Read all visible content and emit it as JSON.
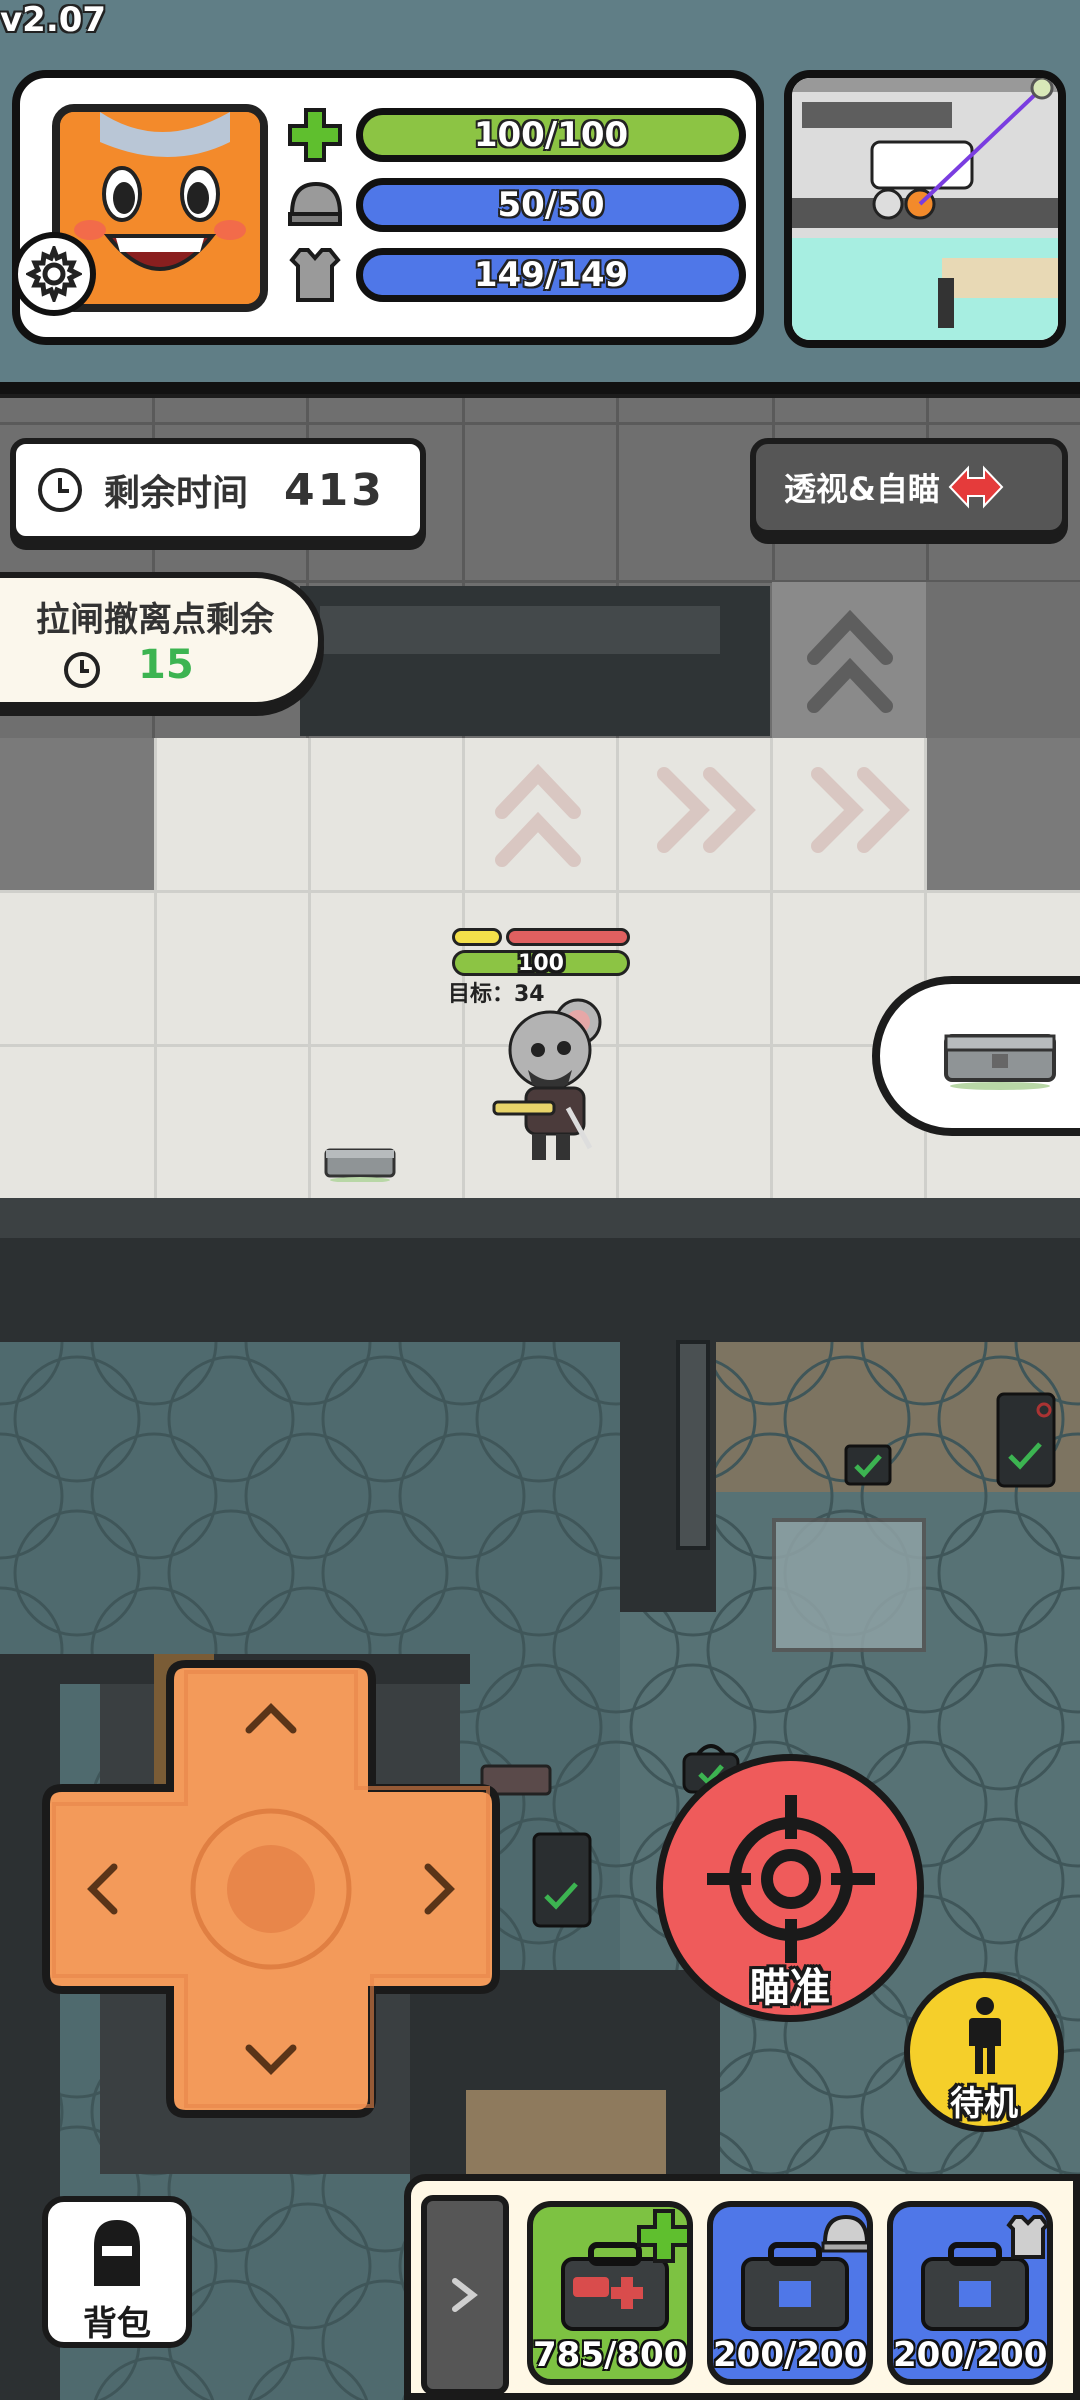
{
  "version": "v2.07",
  "stats": {
    "health": "100/100",
    "helmet": "50/50",
    "armor": "149/149"
  },
  "timer": {
    "label": "剩余时间",
    "value": "413"
  },
  "xray_button": "透视&自瞄",
  "extraction": {
    "label": "拉闸撤离点剩余",
    "value": "15"
  },
  "player": {
    "hp": "100",
    "target_label": "目标：34"
  },
  "aim_button": "瞄准",
  "standby_button": "待机",
  "backpack_button": "背包",
  "quickbar": {
    "expand_icon": "chevron-right-icon",
    "slots": [
      {
        "icon": "medkit-icon",
        "count": "785/800"
      },
      {
        "icon": "helmet-repair-kit-icon",
        "count": "200/200"
      },
      {
        "icon": "armor-repair-kit-icon",
        "count": "200/200"
      }
    ]
  },
  "colors": {
    "health_bar": "#8cc444",
    "shield_bar": "#4f77e8",
    "aim_button": "#ef5b5b",
    "standby_button": "#f5cf2a",
    "dpad": "#f39a5a",
    "timer_green": "#3cb451"
  }
}
